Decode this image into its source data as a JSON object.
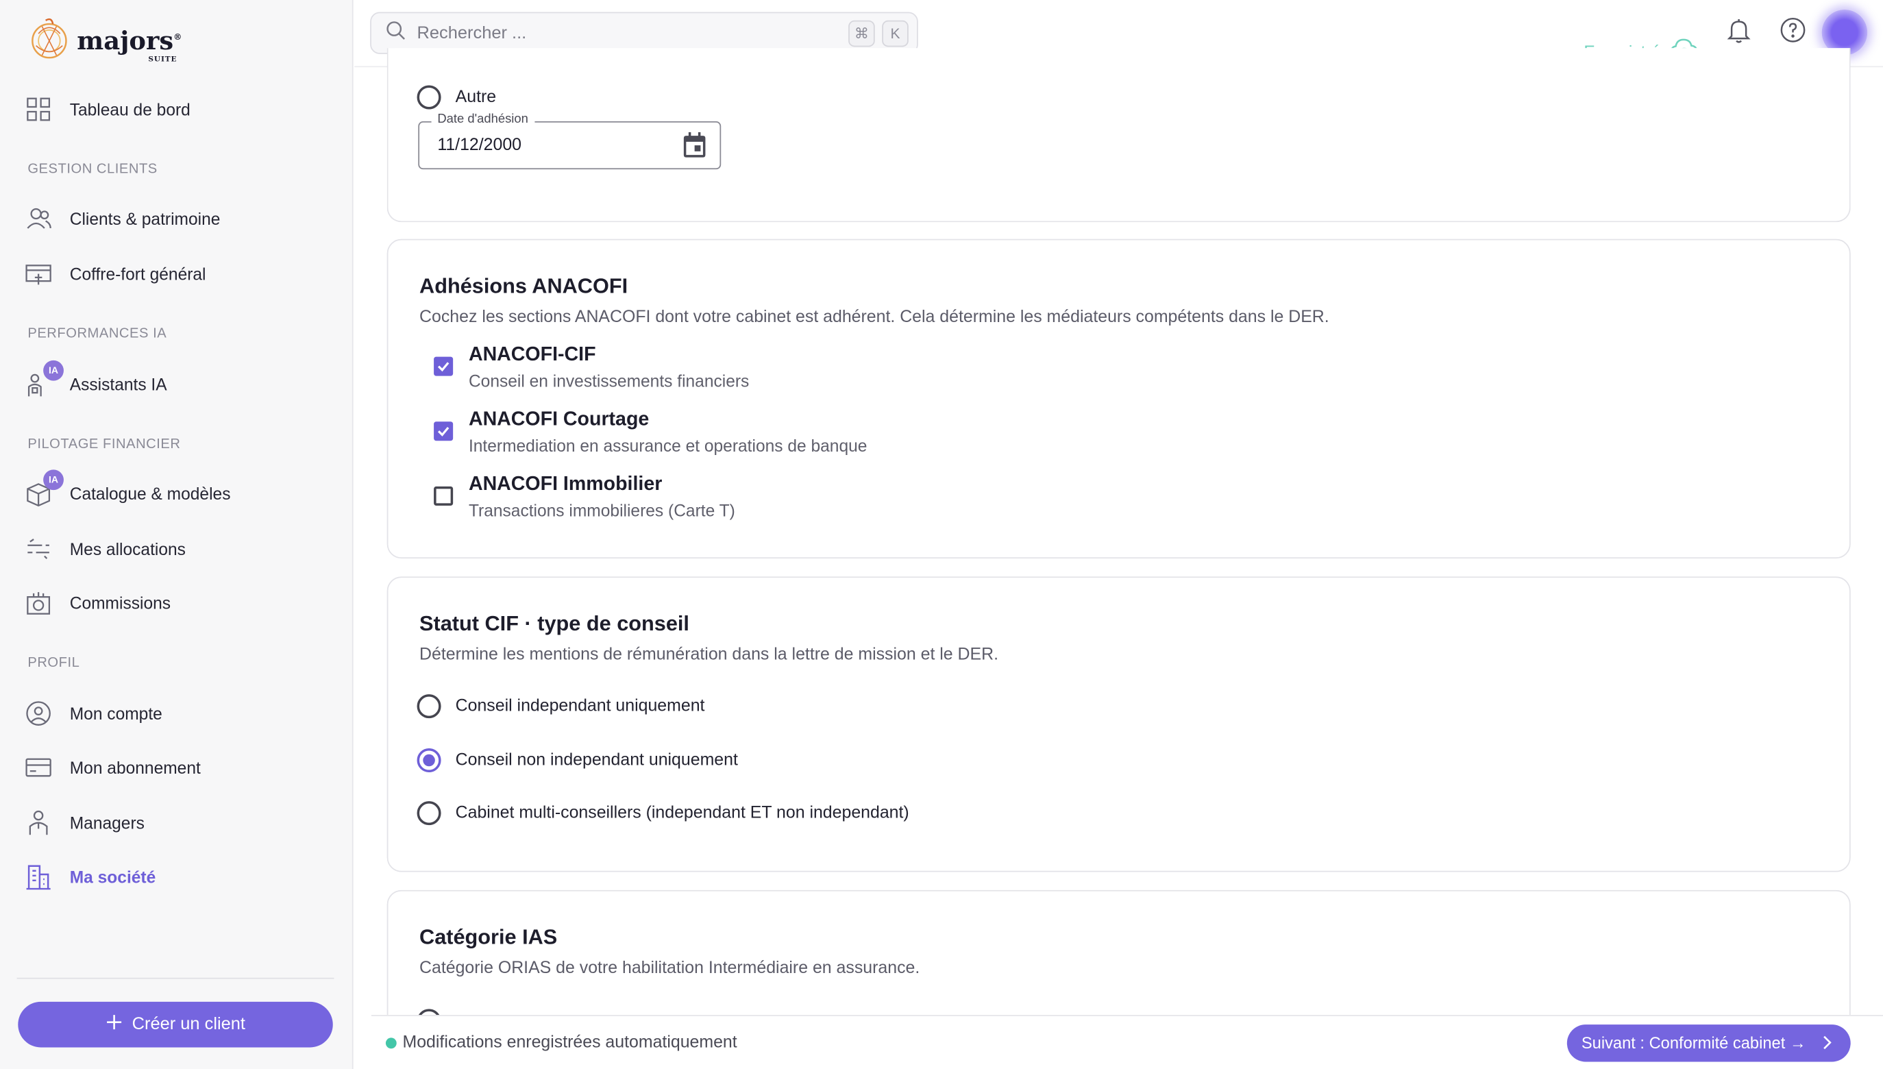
{
  "app": {
    "logo_name": "majors",
    "logo_sub": "SUITE"
  },
  "sidebar": {
    "dashboard": "Tableau de bord",
    "sections": {
      "clients": "GESTION CLIENTS",
      "ia": "PERFORMANCES IA",
      "finance": "PILOTAGE FINANCIER",
      "profil": "PROFIL"
    },
    "items": {
      "clients_patrimoine": "Clients & patrimoine",
      "coffre_fort": "Coffre-fort général",
      "assistants_ia": "Assistants IA",
      "catalogue": "Catalogue & modèles",
      "allocations": "Mes allocations",
      "commissions": "Commissions",
      "mon_compte": "Mon compte",
      "abonnement": "Mon abonnement",
      "managers": "Managers",
      "societe": "Ma société"
    },
    "ia_badge": "IA",
    "create_button": "Créer un client",
    "active_item": "Ma société"
  },
  "topbar": {
    "search_placeholder": "Rechercher ...",
    "shortcut_cmd": "⌘",
    "shortcut_key": "K",
    "save_status": "Enregistré"
  },
  "card_autre": {
    "radio_label": "Autre",
    "date_label": "Date d'adhésion",
    "date_value": "11/12/2000"
  },
  "card_anacofi": {
    "title": "Adhésions ANACOFI",
    "subtitle": "Cochez les sections ANACOFI dont votre cabinet est adhérent. Cela détermine les médiateurs compétents dans le DER.",
    "options": [
      {
        "title": "ANACOFI-CIF",
        "desc": "Conseil en investissements financiers",
        "checked": true
      },
      {
        "title": "ANACOFI Courtage",
        "desc": "Intermediation en assurance et operations de banque",
        "checked": true
      },
      {
        "title": "ANACOFI Immobilier",
        "desc": "Transactions immobilieres (Carte T)",
        "checked": false
      }
    ]
  },
  "card_statut": {
    "title": "Statut CIF · type de conseil",
    "subtitle": "Détermine les mentions de rémunération dans la lettre de mission et le DER.",
    "options": [
      {
        "label": "Conseil independant uniquement",
        "selected": false
      },
      {
        "label": "Conseil non independant uniquement",
        "selected": true
      },
      {
        "label": "Cabinet multi-conseillers (independant ET non independant)",
        "selected": false
      }
    ]
  },
  "card_ias": {
    "title": "Catégorie IAS",
    "subtitle": "Catégorie ORIAS de votre habilitation Intermédiaire en assurance."
  },
  "footer": {
    "autosave": "Modifications enregistrées automatiquement",
    "next_button": "Suivant : Conformité cabinet →"
  },
  "colors": {
    "accent": "#6e5fd8",
    "success": "#43c6a8",
    "saved_text": "#6fd3bd"
  }
}
